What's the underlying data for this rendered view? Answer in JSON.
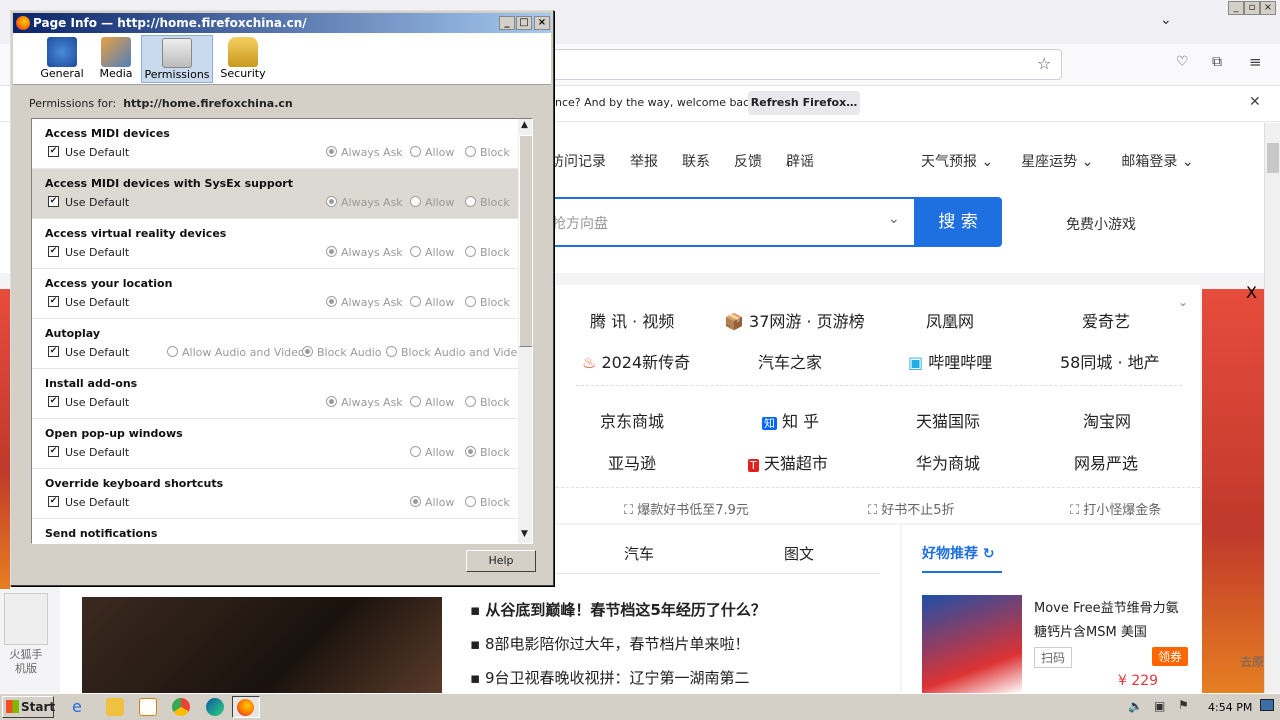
{
  "dialog": {
    "title": "Page Info — http://home.firefoxchina.cn/",
    "tabs": [
      "General",
      "Media",
      "Permissions",
      "Security"
    ],
    "permissions_for_label": "Permissions for:",
    "permissions_for_url": "http://home.firefoxchina.cn",
    "use_default": "Use Default",
    "help": "Help",
    "rows": [
      {
        "title": "Access MIDI devices",
        "options": [
          "Always Ask",
          "Allow",
          "Block"
        ]
      },
      {
        "title": "Access MIDI devices with SysEx support",
        "options": [
          "Always Ask",
          "Allow",
          "Block"
        ]
      },
      {
        "title": "Access virtual reality devices",
        "options": [
          "Always Ask",
          "Allow",
          "Block"
        ]
      },
      {
        "title": "Access your location",
        "options": [
          "Always Ask",
          "Allow",
          "Block"
        ]
      },
      {
        "title": "Autoplay",
        "options": [
          "Allow Audio and Video",
          "Block Audio",
          "Block Audio and Video"
        ]
      },
      {
        "title": "Install add-ons",
        "options": [
          "Always Ask",
          "Allow",
          "Block"
        ]
      },
      {
        "title": "Open pop-up windows",
        "options": [
          "Allow",
          "Block"
        ]
      },
      {
        "title": "Override keyboard shortcuts",
        "options": [
          "Allow",
          "Block"
        ]
      },
      {
        "title": "Send notifications"
      }
    ]
  },
  "browser": {
    "notification": "nce? And by the way, welcome back!",
    "refresh_button": "Refresh Firefox…"
  },
  "site": {
    "top_links": [
      "访问记录",
      "举报",
      "联系",
      "反馈",
      "辟谣"
    ],
    "top_right": [
      "天气预报",
      "星座运势",
      "邮箱登录"
    ],
    "search_placeholder": "抢方向盘",
    "search_button": "搜 索",
    "free_games": "免费小游戏",
    "close_x": "X",
    "grid_row1": [
      "腾 讯 · 视频",
      "37网游 · 页游榜",
      "凤凰网",
      "爱奇艺"
    ],
    "grid_row2": [
      "2024新传奇",
      "汽车之家",
      "哔哩哔哩",
      "58同城 · 地产"
    ],
    "grid_row3": [
      "京东商城",
      "知 乎",
      "天猫国际",
      "淘宝网"
    ],
    "grid_row4": [
      "亚马逊",
      "天猫超市",
      "华为商城",
      "网易严选"
    ],
    "promos": [
      "爆款好书低至7.9元",
      "好书不止5折",
      "打小怪爆金条"
    ],
    "tabs": [
      "汽车",
      "图文"
    ],
    "recommend": "好物推荐",
    "news": [
      "从谷底到巅峰！春节档这5年经历了什么？",
      "8部电影陪你过大年，春节档片单来啦！",
      "9台卫视春晚收视拼：辽宁第一湖南第二"
    ],
    "product_name": "Move Free益节维骨力氨糖钙片含MSM 美国",
    "scan": "扫码",
    "claim": "领券",
    "price": "¥ 229",
    "left_label": "火狐手机版",
    "right_label": "去原"
  },
  "taskbar": {
    "start": "Start",
    "time": "4:54 PM"
  }
}
